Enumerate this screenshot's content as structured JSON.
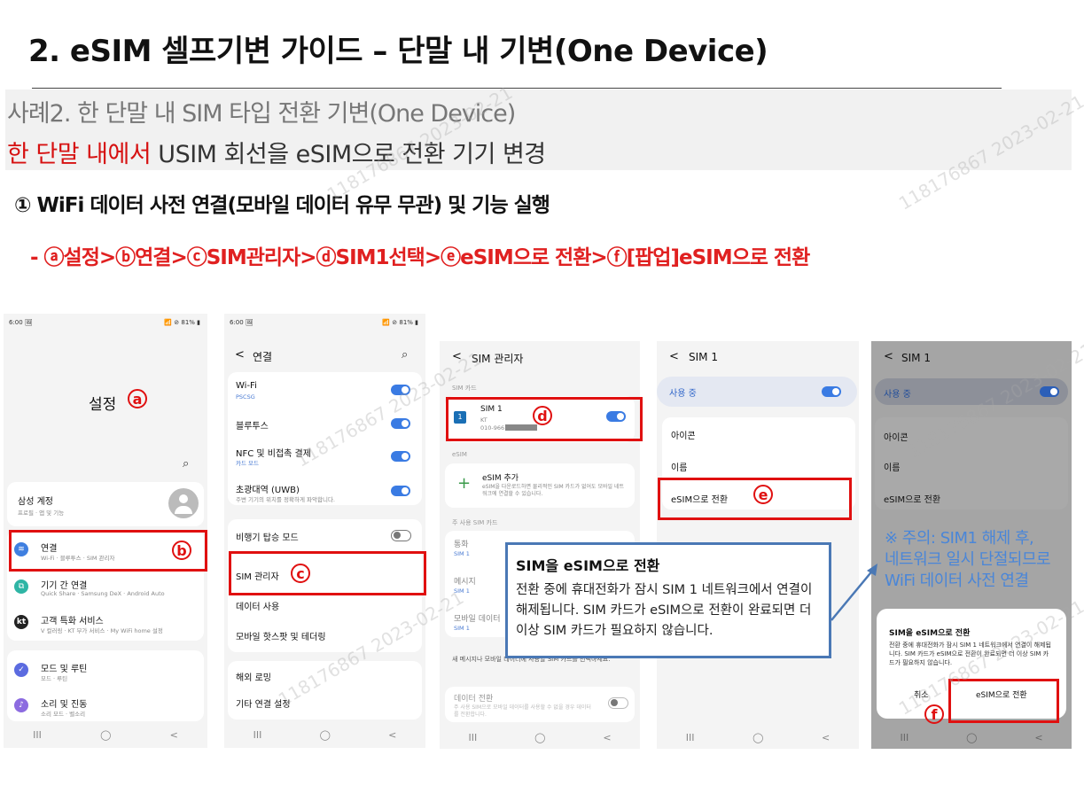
{
  "title": "2. eSIM 셀프기변 가이드 – 단말 내 기변(One Device)",
  "case": {
    "line1": "사례2. 한 단말 내 SIM 타입 전환 기변(One Device)",
    "line2_red": "한 단말 내에서",
    "line2_rest": " USIM 회선을 eSIM으로 전환 기기 변경"
  },
  "step": "① WiFi 데이터 사전 연결(모바일 데이터 유무 무관) 및 기능 실행",
  "path": "- ⓐ설정>ⓑ연결>ⓒSIM관리자>ⓓSIM1선택>ⓔeSIM으로 전환>ⓕ[팝업]eSIM으로 전환",
  "watermark": "118176867  2023-02-21",
  "markers": {
    "a": "a",
    "b": "b",
    "c": "c",
    "d": "d",
    "e": "e",
    "f": "f"
  },
  "nav": {
    "recent": "III",
    "home": "◯",
    "back": "<"
  },
  "screen1": {
    "time": "6:00 🖼",
    "status": "📶 ⊘ 81% ▮",
    "title": "설정",
    "search_icon": "⌕",
    "account_title": "삼성 계정",
    "account_sub": "프로필 · 앱 및 기능",
    "items": [
      {
        "title": "연결",
        "sub": "Wi-Fi · 블루투스 · SIM 관리자",
        "icon": "wifi-icon",
        "color": "#3f7fe0"
      },
      {
        "title": "기기 간 연결",
        "sub": "Quick Share · Samsung DeX · Android Auto",
        "icon": "devices-icon",
        "color": "#2fb5a5"
      },
      {
        "title": "고객 특화 서비스",
        "sub": "V 컬러링 · KT 부가 서비스 · My WiFi home 설정",
        "icon": "kt-icon",
        "color": "#222222"
      },
      {
        "title": "모드 및 루틴",
        "sub": "모드 · 루틴",
        "icon": "check-icon",
        "color": "#5b6be0"
      },
      {
        "title": "소리 및 진동",
        "sub": "소리 모드 · 벨소리",
        "icon": "sound-icon",
        "color": "#8c6be0"
      }
    ]
  },
  "screen2": {
    "time": "6:00 🖼",
    "status": "📶 ⊘ 81% ▮",
    "header": "연결",
    "items": [
      {
        "title": "Wi-Fi",
        "sub": "PSCSG"
      },
      {
        "title": "블루투스",
        "sub": ""
      },
      {
        "title": "NFC 및 비접촉 결제",
        "sub": "카드 모드"
      },
      {
        "title": "초광대역 (UWB)",
        "sub": "주변 기기의 위치를 정확하게 파악합니다."
      },
      {
        "title": "비행기 탑승 모드",
        "sub": ""
      },
      {
        "title": "SIM 관리자",
        "sub": ""
      },
      {
        "title": "데이터 사용",
        "sub": ""
      },
      {
        "title": "모바일 핫스팟 및 테더링",
        "sub": ""
      },
      {
        "title": "해외 로밍",
        "sub": ""
      },
      {
        "title": "기타 연결 설정",
        "sub": ""
      }
    ]
  },
  "screen3": {
    "header": "SIM 관리자",
    "sim_cards_label": "SIM 카드",
    "sim1_name": "SIM 1",
    "sim1_carrier": "KT",
    "sim1_number": "010-966",
    "sim1_badge": "1",
    "esim_label": "eSIM",
    "add_esim": "eSIM 추가",
    "add_esim_sub": "eSIM을 다운로드하면 물리적인 SIM 카드가 없어도 모바일 네트워크에 연결할 수 있습니다.",
    "primary_label": "주 사용 SIM 카드",
    "call": "통화",
    "message": "메시지",
    "mobile_data": "모바일 데이터",
    "sim1": "SIM 1",
    "etc_text": "새 메시지나 모바일 데이터에 사용할 SIM 카드를 선택하세요.",
    "data_switch": "데이터 전환",
    "data_switch_sub": "주 사용 SIM으로 모바일 데이터를 사용할 수 없을 경우 데이터를 전환합니다."
  },
  "screen4": {
    "header": "SIM 1",
    "in_use": "사용 중",
    "icon": "아이콘",
    "name": "이름",
    "convert": "eSIM으로 전환"
  },
  "screen5": {
    "header": "SIM 1",
    "in_use": "사용 중",
    "icon": "아이콘",
    "name": "이름",
    "convert": "eSIM으로 전환",
    "dialog_title": "SIM을 eSIM으로 전환",
    "dialog_body": "전환 중에 휴대전화가 잠시 SIM 1 네트워크에서 연결이 해제됩니다. SIM 카드가 eSIM으로 전환이 완료되면 더 이상 SIM 카드가 필요하지 않습니다.",
    "cancel": "취소",
    "confirm": "eSIM으로 전환"
  },
  "callout": {
    "title": "SIM을 eSIM으로 전환",
    "body": "전환 중에 휴대전화가 잠시 SIM 1 네트워크에서 연결이 해제됩니다. SIM 카드가 eSIM으로 전환이 완료되면 더 이상 SIM 카드가 필요하지 않습니다."
  },
  "note": {
    "line1": "※ 주의: SIM1 해제 후,",
    "line2": "네트워크 일시 단절되므로",
    "line3": "WiFi 데이터 사전 연결"
  },
  "colors": {
    "accent_red": "#e01010",
    "toggle_blue": "#3a7be3",
    "callout_border": "#4a78b5",
    "note_blue": "#4a86d8"
  }
}
